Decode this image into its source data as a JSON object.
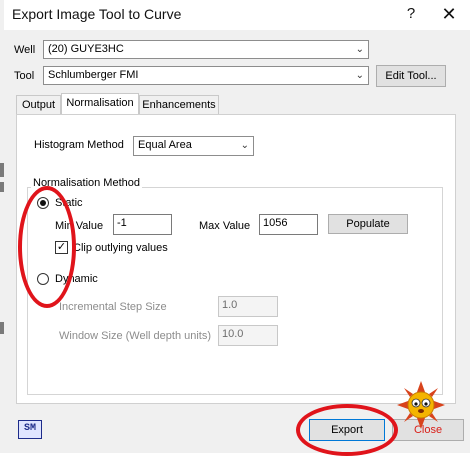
{
  "dialog": {
    "title": "Export Image Tool to Curve",
    "help_label": "?",
    "close_label": "✕"
  },
  "well": {
    "label": "Well",
    "value": "(20) GUYE3HC"
  },
  "tool": {
    "label": "Tool",
    "value": "Schlumberger FMI",
    "edit_button": "Edit Tool..."
  },
  "tabs": [
    {
      "label": "Output",
      "active": false
    },
    {
      "label": "Normalisation",
      "active": true
    },
    {
      "label": "Enhancements",
      "active": false
    }
  ],
  "histogram": {
    "label": "Histogram Method",
    "value": "Equal Area"
  },
  "normalisation": {
    "group_title": "Normalisation Method",
    "static_label": "Static",
    "static_selected": true,
    "min_value_label": "Min Value",
    "min_value": "-1",
    "max_value_label": "Max Value",
    "max_value": "1056",
    "populate_button": "Populate",
    "clip_label": "Clip outlying values",
    "clip_checked": true,
    "dynamic_label": "Dynamic",
    "dynamic_selected": false,
    "step_label": "Incremental Step Size",
    "step_value": "1.0",
    "window_label": "Window Size (Well depth units)",
    "window_value": "10.0"
  },
  "footer": {
    "logo_text": "SM",
    "export_button": "Export",
    "close_button": "Close"
  },
  "colors": {
    "annotation_red": "#e0141b",
    "focus_blue": "#0078d7",
    "dialog_bg": "#f0f0f0"
  },
  "icons": {
    "help": "question-mark-icon",
    "close": "close-icon",
    "combo_arrow": "chevron-down-icon",
    "logo": "sm-logo-icon",
    "emoji": "sun-emoji-icon"
  }
}
